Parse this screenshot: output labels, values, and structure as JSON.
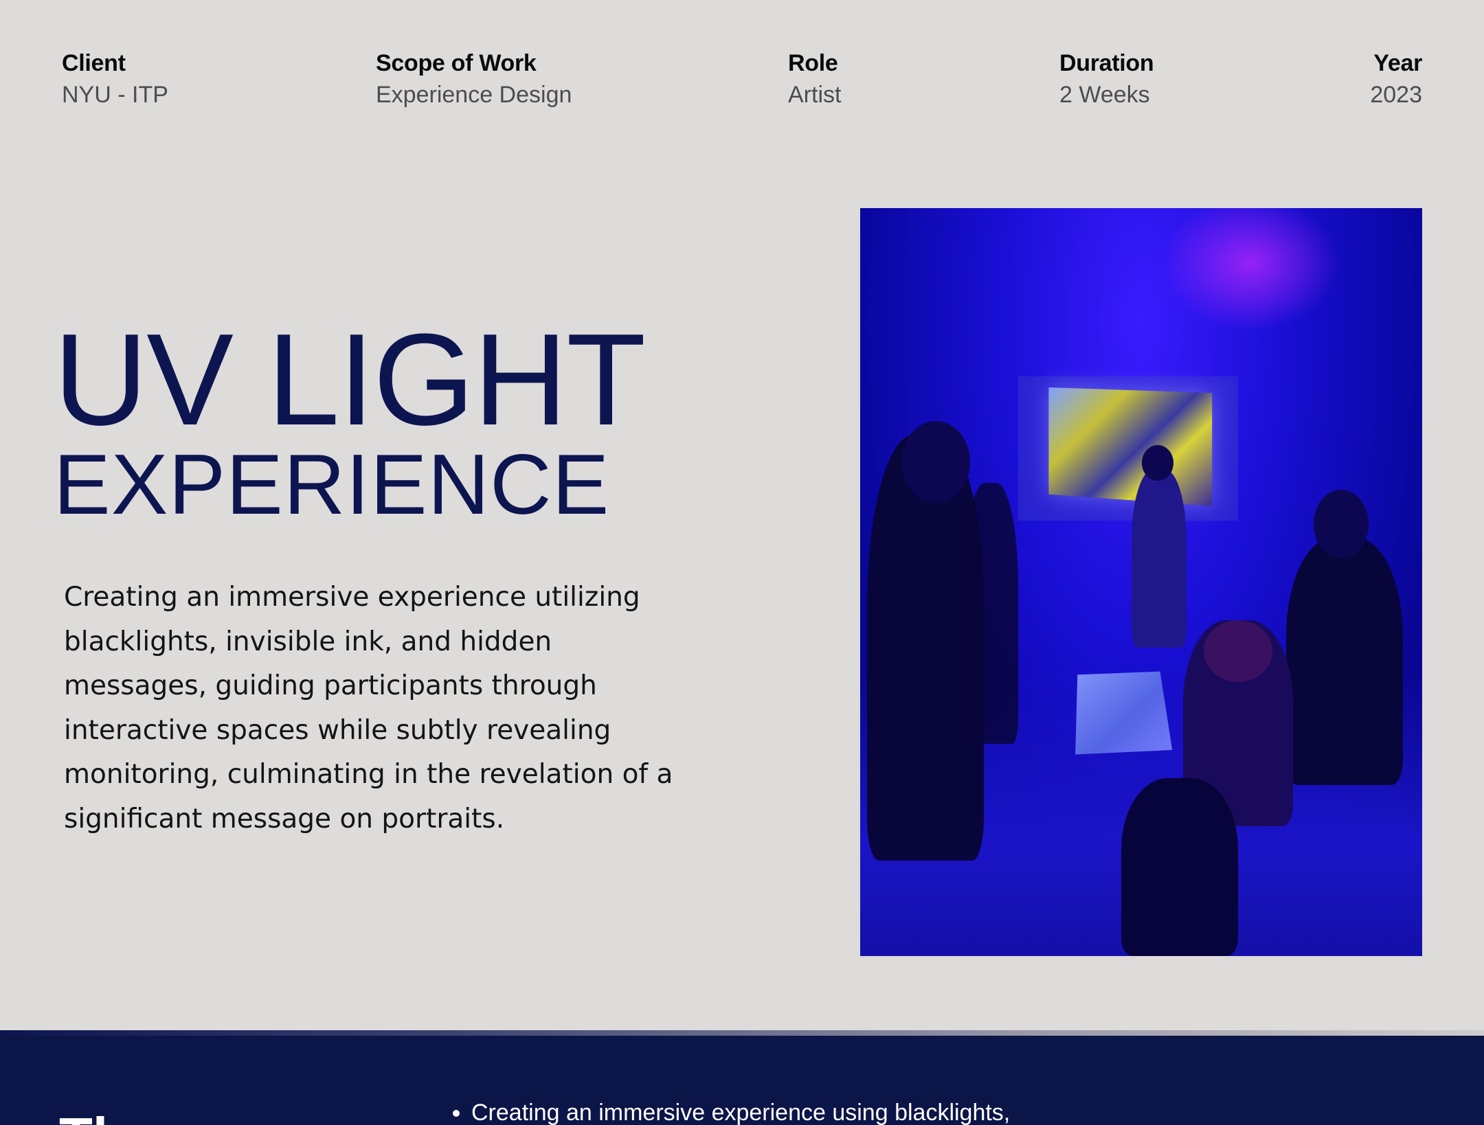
{
  "meta": {
    "client": {
      "label": "Client",
      "value": "NYU - ITP"
    },
    "scope": {
      "label": "Scope of Work",
      "value": "Experience Design"
    },
    "role": {
      "label": "Role",
      "value": "Artist"
    },
    "duration": {
      "label": "Duration",
      "value": "2 Weeks"
    },
    "year": {
      "label": "Year",
      "value": "2023"
    }
  },
  "hero": {
    "title_line1": "UV LIGHT",
    "title_line2": "EXPERIENCE",
    "description": "Creating an immersive experience utilizing blacklights, invisible ink, and hidden messages, guiding participants through interactive spaces while subtly revealing monitoring, culminating in the revelation of a significant message on portraits."
  },
  "footer": {
    "heading": "Th",
    "bullets": [
      "Creating an immersive experience using blacklights,"
    ]
  },
  "colors": {
    "background": "#dedbdb",
    "title": "#0d1550",
    "footer_bg": "#0c1548"
  }
}
